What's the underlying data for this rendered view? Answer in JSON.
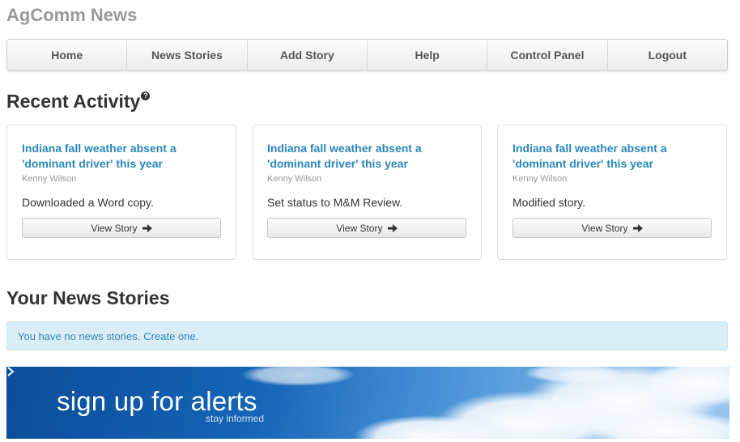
{
  "site": {
    "title": "AgComm News"
  },
  "nav": {
    "items": [
      {
        "label": "Home"
      },
      {
        "label": "News Stories"
      },
      {
        "label": "Add Story"
      },
      {
        "label": "Help"
      },
      {
        "label": "Control Panel"
      },
      {
        "label": "Logout"
      }
    ]
  },
  "recent_activity": {
    "title": "Recent Activity",
    "help_icon": "question-icon",
    "cards": [
      {
        "title": "Indiana fall weather absent a 'dominant driver' this year",
        "author": "Kenny Wilson",
        "action": "Downloaded a Word copy.",
        "button_label": "View Story"
      },
      {
        "title": "Indiana fall weather absent a 'dominant driver' this year",
        "author": "Kenny Wilson",
        "action": "Set status to M&M Review.",
        "button_label": "View Story"
      },
      {
        "title": "Indiana fall weather absent a 'dominant driver' this year",
        "author": "Kenny Wilson",
        "action": "Modified story.",
        "button_label": "View Story"
      }
    ]
  },
  "your_stories": {
    "title": "Your News Stories",
    "empty_message": "You have no news stories.",
    "create_link": "Create one."
  },
  "banner": {
    "headline": "sign up for alerts",
    "subtext": "stay informed"
  },
  "colors": {
    "link": "#2a86b8",
    "alert_bg": "#d9edf7",
    "alert_text": "#3a87ad",
    "banner_blue": "#0b4d9a"
  }
}
